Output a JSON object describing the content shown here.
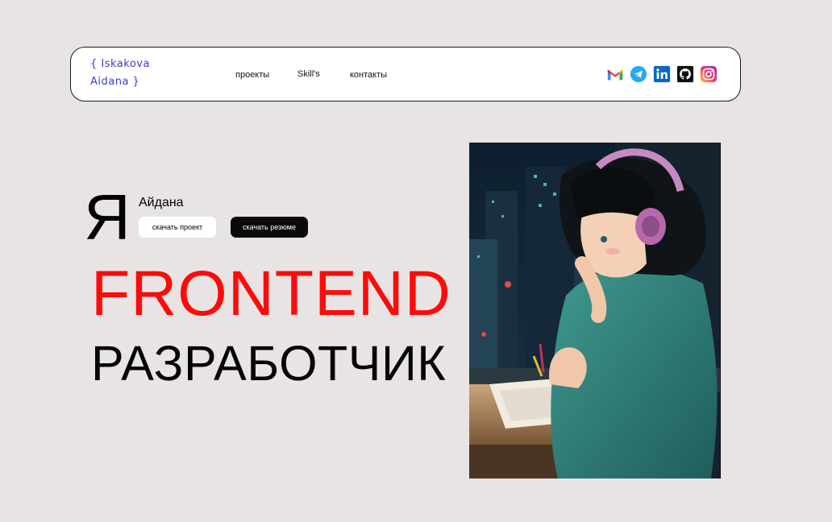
{
  "header": {
    "logo_line1": "{ Iskakova",
    "logo_line2": "Aidana }",
    "nav": [
      {
        "label": "проекты"
      },
      {
        "label": "Skill's"
      },
      {
        "label": "контакты"
      }
    ],
    "socials": [
      "gmail-icon",
      "telegram-icon",
      "linkedin-icon",
      "github-icon",
      "instagram-icon"
    ]
  },
  "hero": {
    "ya": "Я",
    "name": "Айдана",
    "btn_project": "скачать проект",
    "btn_resume": "скачать резюме",
    "title_line1": "FRONTEND",
    "title_line2": "РАЗРАБОТЧИК"
  },
  "colors": {
    "background": "#e9e4e4",
    "accent_red": "#ff0a0a",
    "logo_blue": "#3b3bd1"
  }
}
